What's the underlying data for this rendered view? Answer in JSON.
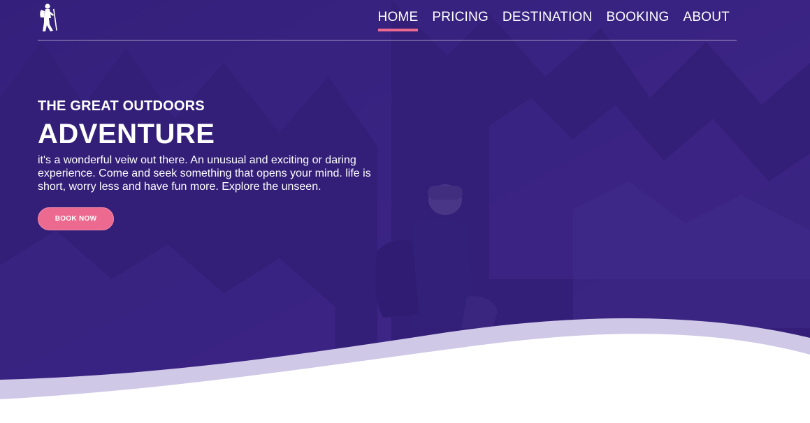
{
  "colors": {
    "overlay": "#3a1e8c",
    "accent": "#ec6a8f",
    "text": "#ffffff",
    "wave_light": "#cfc8e6",
    "wave_white": "#ffffff"
  },
  "logo": {
    "icon": "hiker-icon"
  },
  "nav": {
    "items": [
      {
        "label": "HOME",
        "active": true
      },
      {
        "label": "PRICING",
        "active": false
      },
      {
        "label": "DESTINATION",
        "active": false
      },
      {
        "label": "BOOKING",
        "active": false
      },
      {
        "label": "ABOUT",
        "active": false
      }
    ]
  },
  "hero": {
    "eyebrow": "THE GREAT OUTDOORS",
    "headline": "ADVENTURE",
    "description": "it's a wonderful veiw out there. An unusual and exciting or daring experience. Come and seek something that opens your mind. life is short, worry less and have fun more. Explore the unseen.",
    "cta_label": "BOOK NOW"
  }
}
